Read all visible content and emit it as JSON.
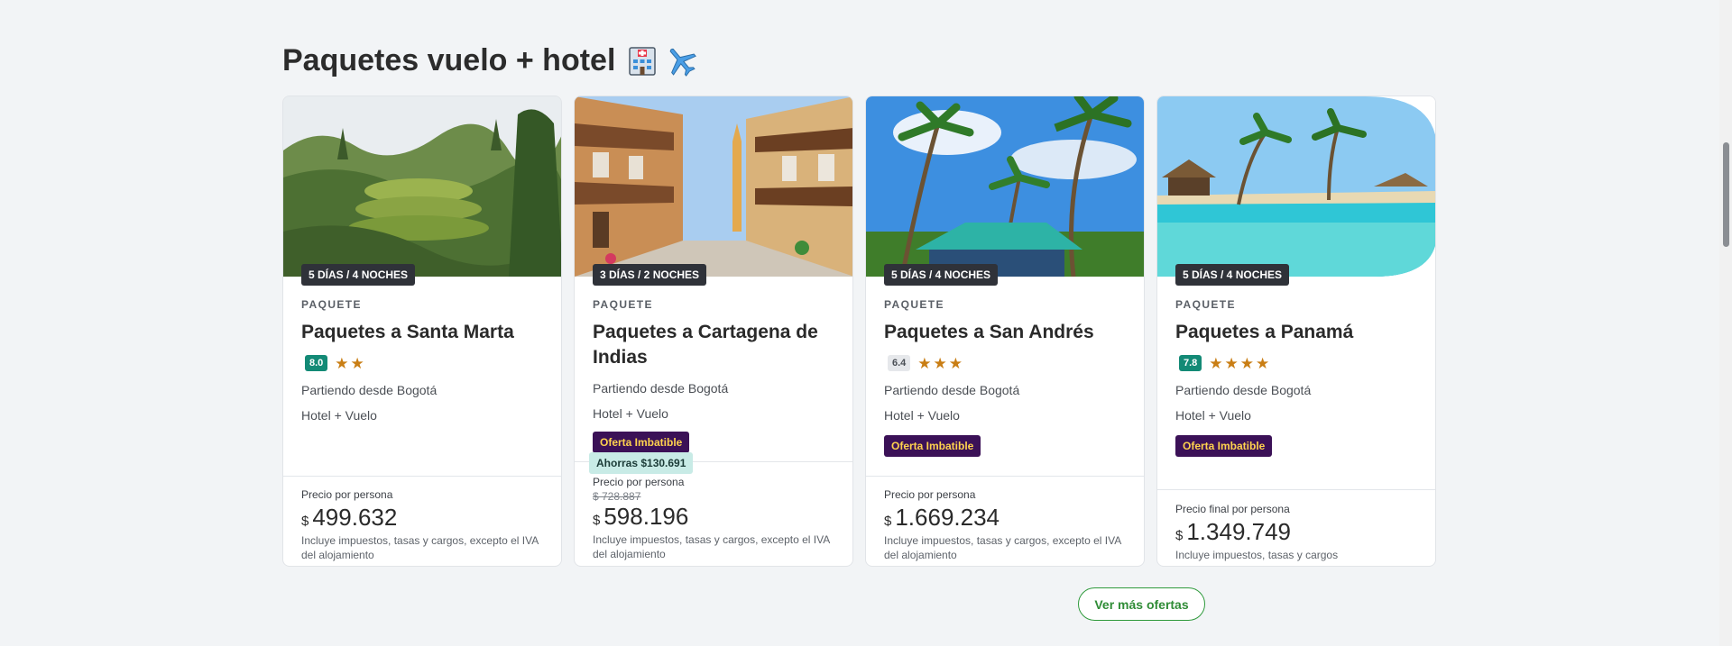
{
  "section": {
    "title": "Paquetes vuelo + hotel",
    "icons": [
      "hotel-icon",
      "airplane-icon"
    ]
  },
  "cards": [
    {
      "duration": "5 DÍAS / 4 NOCHES",
      "kind": "PAQUETE",
      "title": "Paquetes a Santa Marta",
      "score": "8.0",
      "stars": 2,
      "origin": "Partiendo desde Bogotá",
      "includes": "Hotel + Vuelo",
      "offer": "",
      "savings": "",
      "price_label": "Precio por persona",
      "old_price": "",
      "currency": "$",
      "price": "499.632",
      "tax_note": "Incluye impuestos, tasas y cargos, excepto el IVA del alojamiento"
    },
    {
      "duration": "3 DÍAS / 2 NOCHES",
      "kind": "PAQUETE",
      "title": "Paquetes a Cartagena de Indias",
      "score": "",
      "stars": 0,
      "origin": "Partiendo desde Bogotá",
      "includes": "Hotel + Vuelo",
      "offer": "Oferta Imbatible",
      "savings": "Ahorras $130.691",
      "price_label": "Precio por persona",
      "old_price": "$ 728.887",
      "currency": "$",
      "price": "598.196",
      "tax_note": "Incluye impuestos, tasas y cargos, excepto el IVA del alojamiento"
    },
    {
      "duration": "5 DÍAS / 4 NOCHES",
      "kind": "PAQUETE",
      "title": "Paquetes a San Andrés",
      "score": "6.4",
      "stars": 3,
      "origin": "Partiendo desde Bogotá",
      "includes": "Hotel + Vuelo",
      "offer": "Oferta Imbatible",
      "savings": "",
      "price_label": "Precio por persona",
      "old_price": "",
      "currency": "$",
      "price": "1.669.234",
      "tax_note": "Incluye impuestos, tasas y cargos, excepto el IVA del alojamiento"
    },
    {
      "duration": "5 DÍAS / 4 NOCHES",
      "kind": "PAQUETE",
      "title": "Paquetes a Panamá",
      "score": "7.8",
      "stars": 4,
      "origin": "Partiendo desde Bogotá",
      "includes": "Hotel + Vuelo",
      "offer": "Oferta Imbatible",
      "savings": "",
      "price_label": "Precio final por persona",
      "old_price": "",
      "currency": "$",
      "price": "1.349.749",
      "tax_note": "Incluye impuestos, tasas y cargos"
    }
  ],
  "more_button": "Ver más ofertas",
  "colors": {
    "score_good": "#138a76",
    "offer_bg": "#3b1157",
    "offer_text": "#ffd34e",
    "star": "#c97e14",
    "button_green": "#2f9a3c"
  }
}
